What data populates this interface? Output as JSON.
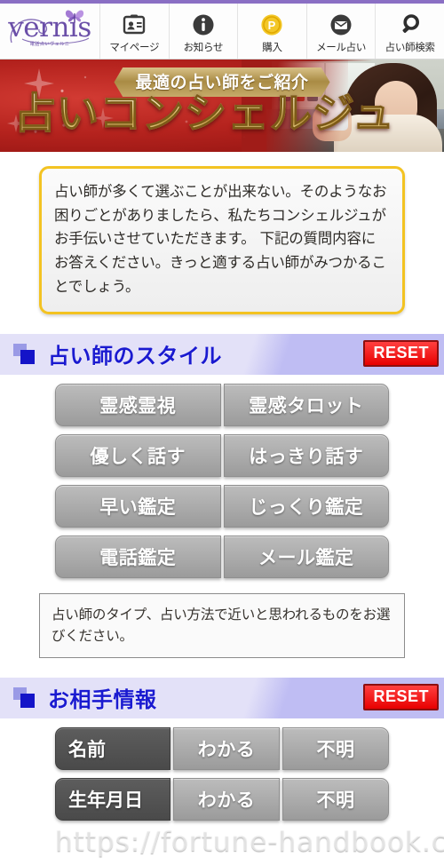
{
  "brand": {
    "logo_word": "vernis",
    "logo_sub": "電話占いヴェルニ",
    "accent_purple": "#6b4fa8"
  },
  "header": {
    "nav": [
      {
        "label": "マイページ",
        "icon": "id-card-icon"
      },
      {
        "label": "お知らせ",
        "icon": "info-circle-icon"
      },
      {
        "label": "購入",
        "icon": "point-coin-icon"
      },
      {
        "label": "メール占い",
        "icon": "mail-circle-icon"
      },
      {
        "label": "占い師検索",
        "icon": "search-icon"
      }
    ]
  },
  "hero": {
    "badge": "最適の占い師をご紹介",
    "title": "占いコンシェルジュ",
    "bg_red": "#b5231e",
    "gold": "#c19a3e"
  },
  "intro": {
    "text": "占い師が多くて選ぶことが出来ない。そのようなお困りごとがありましたら、私たちコンシェルジュがお手伝いさせていただきます。\n下記の質問内容にお答えください。きっと適する占い師がみつかることでしょう。",
    "border_color": "#f3c322"
  },
  "sections": [
    {
      "title": "占い師のスタイル",
      "reset_label": "RESET",
      "rows": [
        {
          "options": [
            "霊感霊視",
            "霊感タロット"
          ]
        },
        {
          "options": [
            "優しく話す",
            "はっきり話す"
          ]
        },
        {
          "options": [
            "早い鑑定",
            "じっくり鑑定"
          ]
        },
        {
          "options": [
            "電話鑑定",
            "メール鑑定"
          ]
        }
      ],
      "hint": "占い師のタイプ、占い方法で近いと思われるものをお選びください。"
    },
    {
      "title": "お相手情報",
      "reset_label": "RESET",
      "label_rows": [
        {
          "label": "名前",
          "options": [
            "わかる",
            "不明"
          ]
        },
        {
          "label": "生年月日",
          "options": [
            "わかる",
            "不明"
          ]
        }
      ]
    }
  ],
  "watermark": "https://fortune-handbook.com/",
  "colors": {
    "section_header_light": "#e3e1f8",
    "section_header_dark": "#bfbdf3",
    "section_title_blue": "#1a1ad0",
    "reset_red": "#e80000",
    "option_gray": "#9b9b9b",
    "label_dark": "#4a4a4a"
  }
}
